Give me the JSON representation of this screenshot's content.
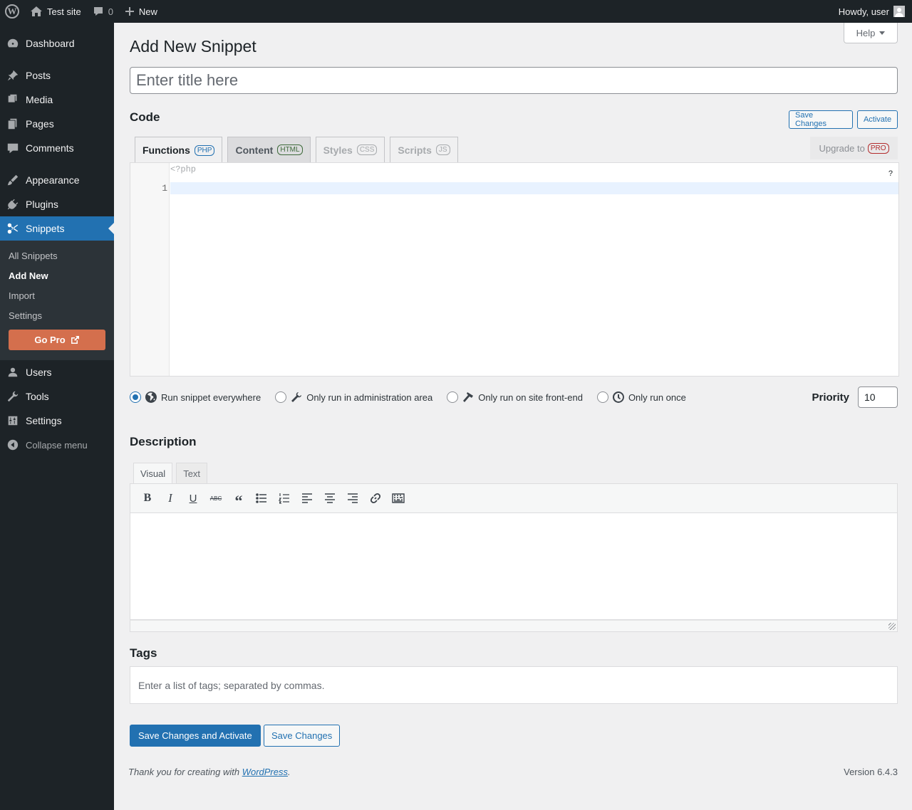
{
  "adminbar": {
    "site_name": "Test site",
    "comments_count": "0",
    "new_label": "New",
    "howdy": "Howdy, user"
  },
  "sidebar": {
    "items": [
      {
        "label": "Dashboard",
        "icon": "dashboard-icon"
      },
      {
        "label": "Posts",
        "icon": "pin-icon"
      },
      {
        "label": "Media",
        "icon": "media-icon"
      },
      {
        "label": "Pages",
        "icon": "pages-icon"
      },
      {
        "label": "Comments",
        "icon": "comment-icon"
      },
      {
        "label": "Appearance",
        "icon": "brush-icon"
      },
      {
        "label": "Plugins",
        "icon": "plugin-icon"
      },
      {
        "label": "Snippets",
        "icon": "scissors-icon"
      },
      {
        "label": "Users",
        "icon": "user-icon"
      },
      {
        "label": "Tools",
        "icon": "wrench-icon"
      },
      {
        "label": "Settings",
        "icon": "sliders-icon"
      }
    ],
    "submenu": [
      "All Snippets",
      "Add New",
      "Import",
      "Settings"
    ],
    "go_pro": "Go Pro",
    "collapse": "Collapse menu"
  },
  "main": {
    "help": "Help",
    "page_title": "Add New Snippet",
    "title_placeholder": "Enter title here",
    "code_heading": "Code",
    "save_changes_small": "Save Changes",
    "activate_small": "Activate",
    "tabs": [
      {
        "label": "Functions",
        "badge": "PHP"
      },
      {
        "label": "Content",
        "badge": "HTML"
      },
      {
        "label": "Styles",
        "badge": "CSS"
      },
      {
        "label": "Scripts",
        "badge": "JS"
      }
    ],
    "upgrade_label": "Upgrade to",
    "upgrade_badge": "PRO",
    "editor": {
      "php_open": "<?php",
      "line_number": "1",
      "help_mark": "?"
    },
    "scope_options": [
      {
        "label": "Run snippet everywhere",
        "icon": "globe-icon",
        "checked": true
      },
      {
        "label": "Only run in administration area",
        "icon": "wrench-icon",
        "checked": false
      },
      {
        "label": "Only run on site front-end",
        "icon": "hammer-icon",
        "checked": false
      },
      {
        "label": "Only run once",
        "icon": "clock-icon",
        "checked": false
      }
    ],
    "priority_label": "Priority",
    "priority_value": "10",
    "description_heading": "Description",
    "desc_tabs": [
      "Visual",
      "Text"
    ],
    "tags_heading": "Tags",
    "tags_placeholder": "Enter a list of tags; separated by commas.",
    "save_activate_button": "Save Changes and Activate",
    "save_button": "Save Changes"
  },
  "footer": {
    "thanks_prefix": "Thank you for creating with ",
    "thanks_link": "WordPress",
    "thanks_suffix": ".",
    "version": "Version 6.4.3"
  },
  "colors": {
    "accent": "#2271b1",
    "sidebar_bg": "#1d2327",
    "go_pro": "#d46f4d"
  }
}
